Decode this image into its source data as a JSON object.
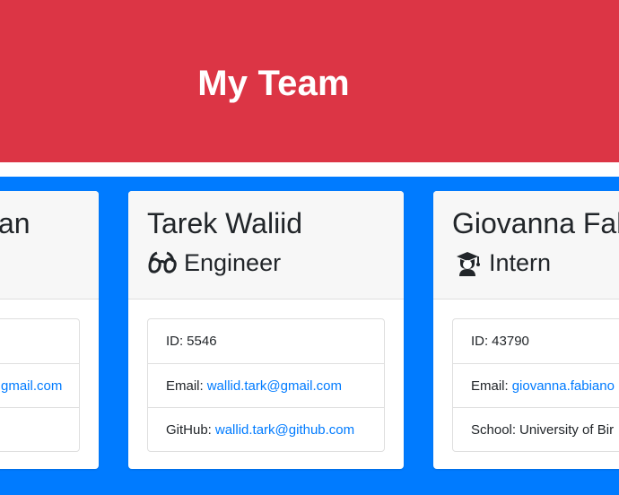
{
  "header": {
    "title": "My Team"
  },
  "team": [
    {
      "name_visible": "an",
      "email_visible": "gmail.com"
    },
    {
      "name": "Tarek Waliid",
      "role": "Engineer",
      "role_icon": "glasses-icon",
      "id_label": "ID:",
      "id": "5546",
      "email_label": "Email:",
      "email": "wallid.tark@gmail.com",
      "github_label": "GitHub:",
      "github": "wallid.tark@github.com"
    },
    {
      "name": "Giovanna Fab",
      "role": "Intern",
      "role_icon": "graduate-icon",
      "id_label": "ID:",
      "id": "43790",
      "email_label": "Email:",
      "email": "giovanna.fabiano",
      "school_label": "School:",
      "school": "University of Bir"
    }
  ],
  "colors": {
    "header": "#dc3545",
    "background": "#007bff",
    "link": "#007bff",
    "card_header": "#f7f7f7"
  }
}
